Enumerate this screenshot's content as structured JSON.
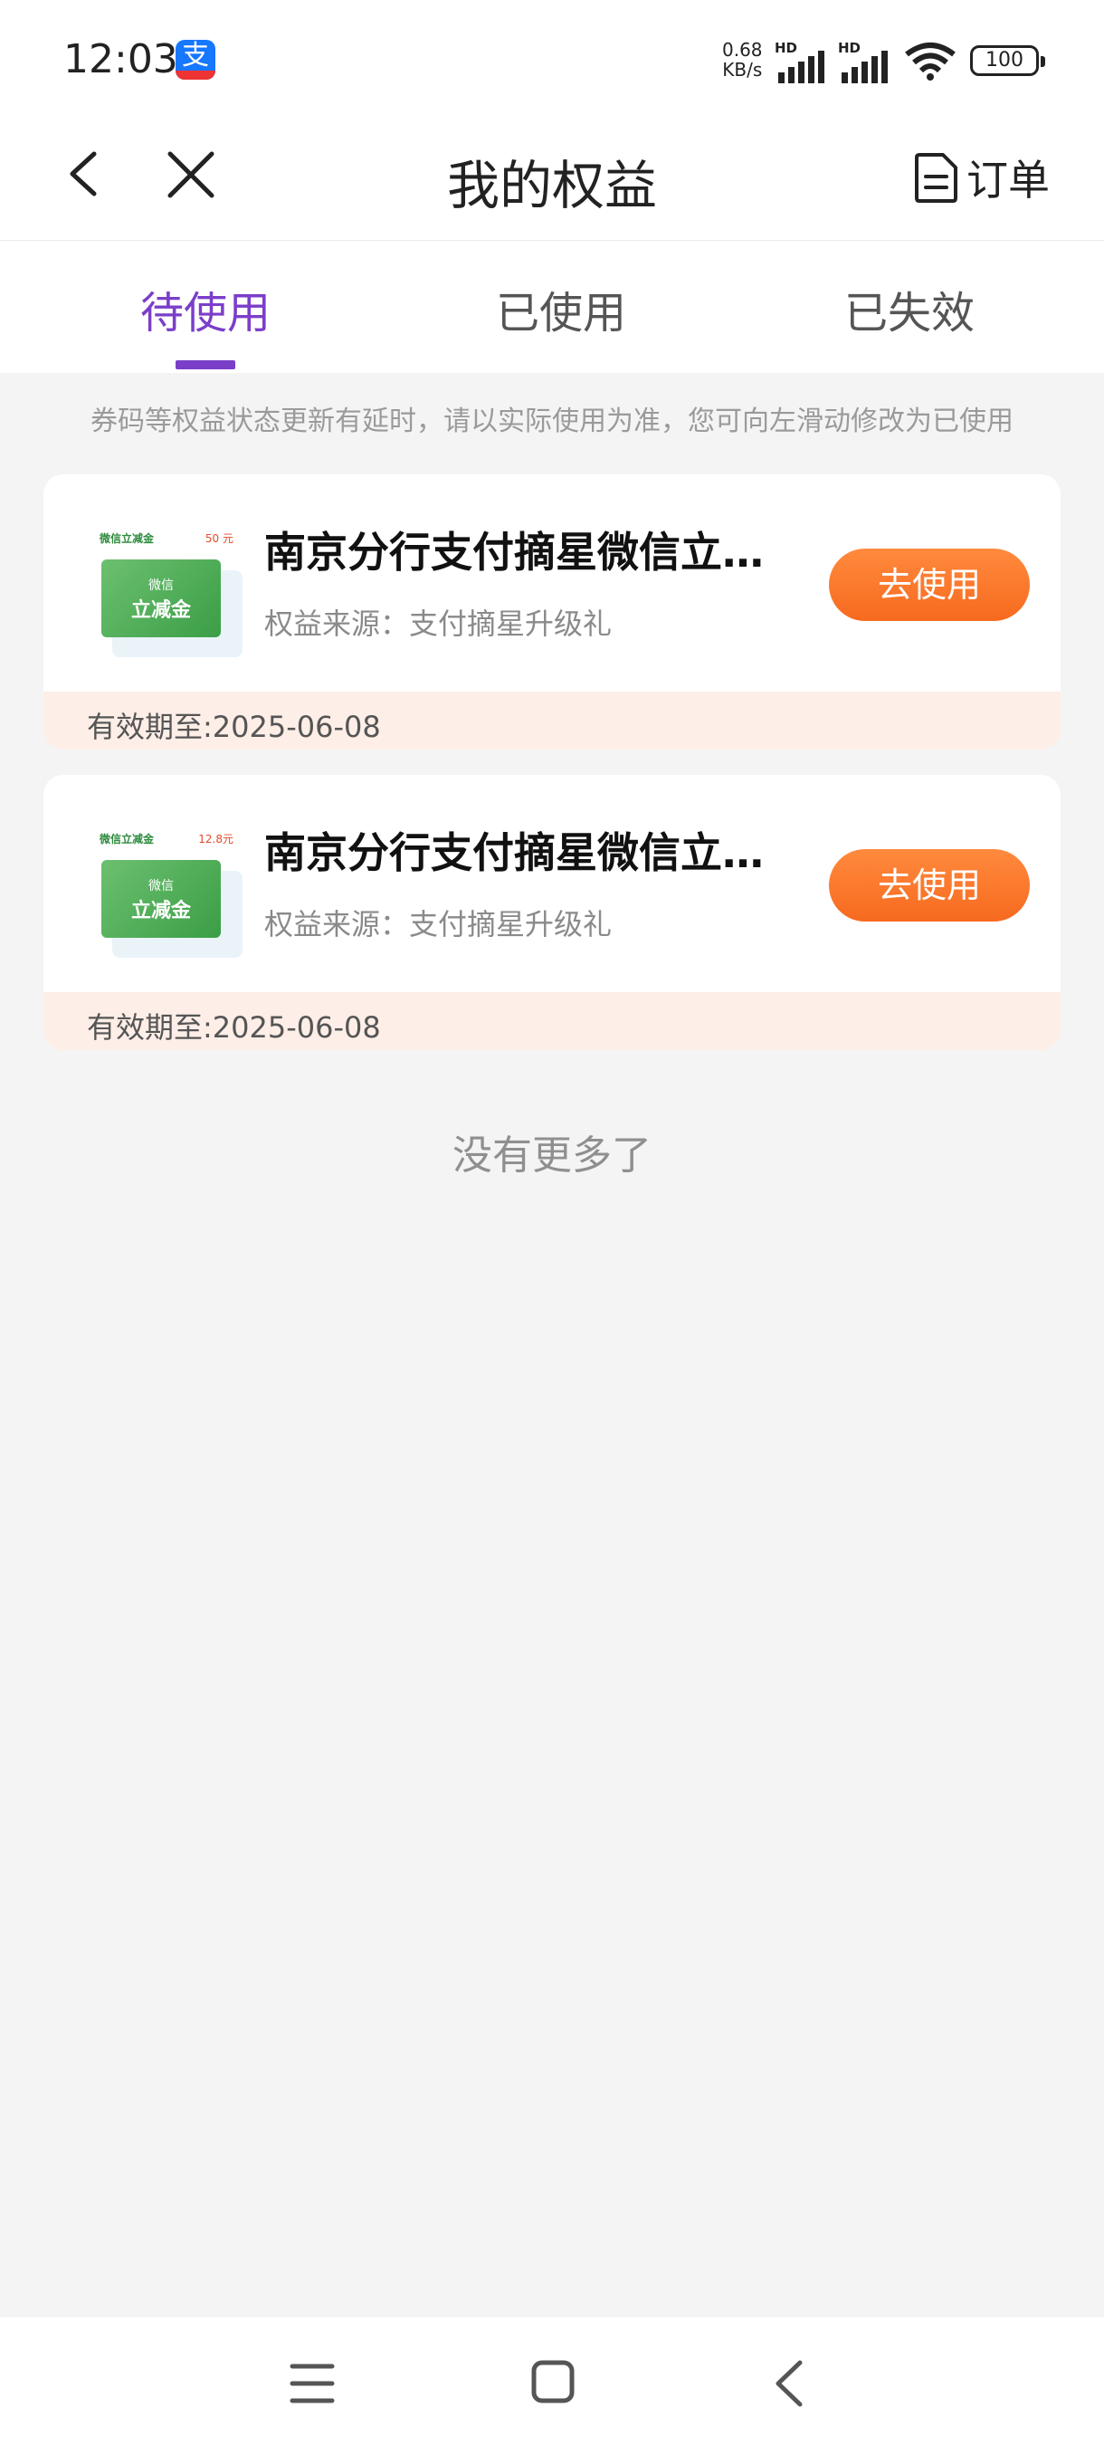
{
  "status_bar": {
    "time": "12:03",
    "app_icon": "alipay-icon",
    "net_speed_value": "0.68",
    "net_speed_unit": "KB/s",
    "sim1_label": "HD",
    "sim2_label": "HD",
    "battery": "100"
  },
  "nav": {
    "title": "我的权益",
    "order_label": "订单"
  },
  "tabs": [
    {
      "label": "待使用",
      "active": true
    },
    {
      "label": "已使用",
      "active": false
    },
    {
      "label": "已失效",
      "active": false
    }
  ],
  "notice": "券码等权益状态更新有延时，请以实际使用为准，您可向左滑动修改为已使用",
  "cards": [
    {
      "title": "南京分行支付摘星微信立…",
      "source": "权益来源：支付摘星升级礼",
      "button": "去使用",
      "expiry": "有效期至:2025-06-08",
      "coupon": {
        "head": "微信立减金",
        "amount": "50 元",
        "brand": "微信",
        "name": "立减金"
      }
    },
    {
      "title": "南京分行支付摘星微信立…",
      "source": "权益来源：支付摘星升级礼",
      "button": "去使用",
      "expiry": "有效期至:2025-06-08",
      "coupon": {
        "head": "微信立减金",
        "amount": "12.8元",
        "brand": "微信",
        "name": "立减金"
      }
    }
  ],
  "no_more": "没有更多了",
  "colors": {
    "accent": "#7b3ec9",
    "button": "#f76a1f",
    "footer_bg": "#fdeee7",
    "page_bg": "#f4f4f4"
  }
}
